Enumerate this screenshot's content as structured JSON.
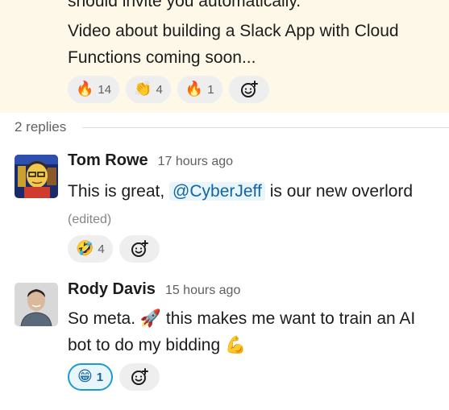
{
  "parent": {
    "cut_line": "should invite you automatically.",
    "text": "Video about building a Slack App with Cloud Functions coming soon...",
    "reactions": [
      {
        "emoji": "🔥",
        "count": "14"
      },
      {
        "emoji": "👏",
        "count": "4"
      },
      {
        "emoji": "🔥",
        "count": "1"
      }
    ]
  },
  "thread": {
    "replies_count": "2 replies"
  },
  "replies": [
    {
      "author": "Tom Rowe",
      "time": "17 hours ago",
      "text_before": "This is great, ",
      "mention": "@CyberJeff",
      "text_after": " is our new overlord",
      "edited": "(edited)",
      "reactions": [
        {
          "emoji": "🤣",
          "count": "4"
        }
      ]
    },
    {
      "author": "Rody Davis",
      "time": "15 hours ago",
      "text_part1": "So meta. ",
      "emoji1": "🚀",
      "text_part2": " this makes me want to train an AI bot to do my bidding ",
      "emoji2": "💪",
      "reactions": [
        {
          "emoji": "😁",
          "count": "1"
        }
      ]
    }
  ],
  "icons": {
    "add_reaction": "add-reaction-icon",
    "avatar_tom": "avatar-cartoon",
    "avatar_rody": "avatar-photo"
  },
  "colors": {
    "highlight_bg": "#fdf8e7",
    "link": "#1264a3",
    "mine_border": "#1d9bd1"
  }
}
